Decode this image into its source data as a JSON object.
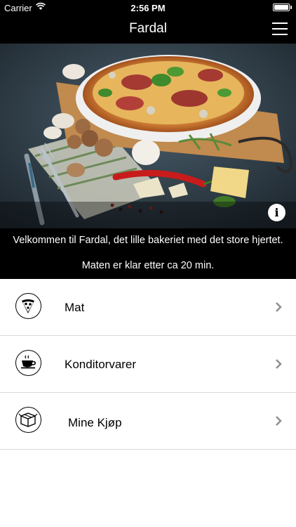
{
  "status_bar": {
    "carrier": "Carrier",
    "time": "2:56 PM",
    "battery_level": 1.0
  },
  "nav": {
    "title": "Fardal",
    "menu_icon": "hamburger-menu-icon"
  },
  "hero": {
    "image": "pizza-table-photo",
    "info_label": "i"
  },
  "welcome": {
    "line1": "Velkommen til Fardal, det lille bakeriet med det store hjertet.",
    "line2": "Maten er klar etter ca 20 min."
  },
  "menu": {
    "items": [
      {
        "label": "Mat",
        "icon": "pizza-slice-icon"
      },
      {
        "label": "Konditorvarer",
        "icon": "coffee-cup-icon"
      },
      {
        "label": "Mine Kjøp",
        "icon": "box-icon"
      }
    ]
  },
  "colors": {
    "bar_background": "#000000",
    "bar_text": "#ffffff",
    "list_background": "#ffffff",
    "divider": "#d8d8d8",
    "chevron": "#8e8e93"
  }
}
